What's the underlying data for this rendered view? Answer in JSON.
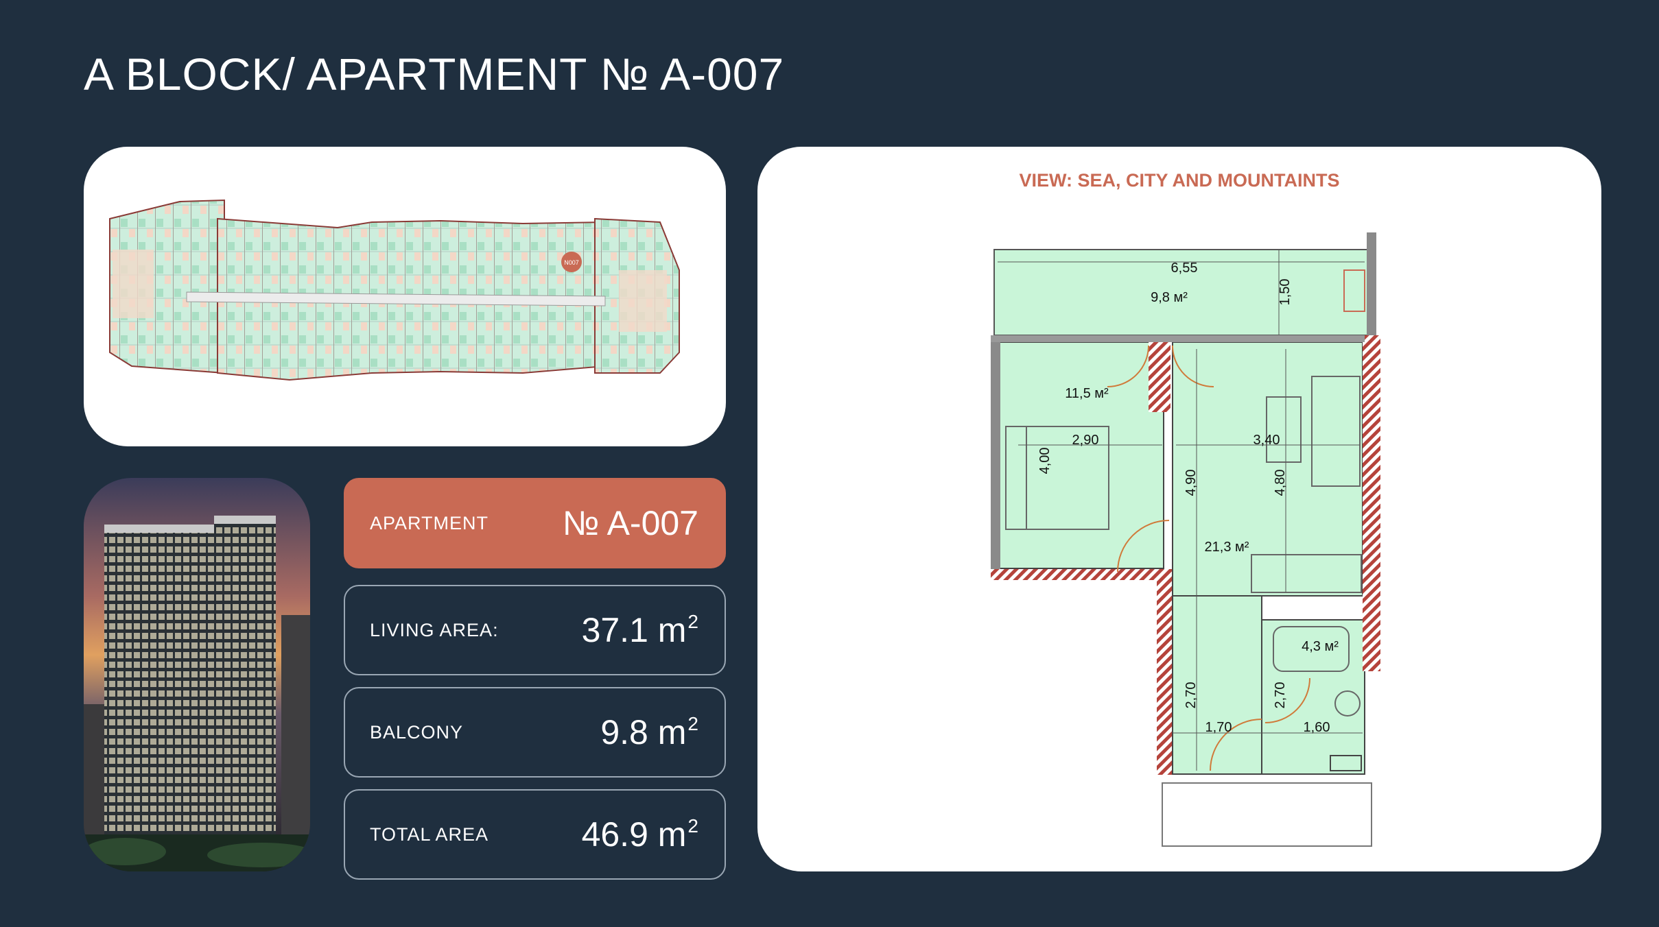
{
  "header": {
    "title": "A BLOCK/ APARTMENT № A-007"
  },
  "floorplan": {
    "marker": "N007"
  },
  "apartment": {
    "label": "APARTMENT",
    "number": "№ A-007",
    "living_area": {
      "label": "LIVING AREA:",
      "value": "37.1 m",
      "unit_sup": "2"
    },
    "balcony": {
      "label": "BALCONY",
      "value": "9.8 m",
      "unit_sup": "2"
    },
    "total_area": {
      "label": "TOTAL AREA",
      "value": "46.9 m",
      "unit_sup": "2"
    }
  },
  "plan": {
    "view": "VIEW: SEA, CITY AND MOUNTAINTS",
    "balcony_width": "6,55",
    "balcony_area": "9,8 м²",
    "balcony_depth": "1,50",
    "bedroom_area": "11,5 м²",
    "bedroom_width": "2,90",
    "bedroom_depth": "4,00",
    "living_width": "3,40",
    "living_depth_left": "4,90",
    "living_depth_right": "4,80",
    "living_area": "21,3 м²",
    "bath_area": "4,3 м²",
    "hall_depth": "2,70",
    "hall_width": "1,70",
    "bath_depth": "2,70",
    "bath_width": "1,60"
  },
  "colors": {
    "background": "#1f2f3f",
    "accent": "#c96a54",
    "room_fill": "#c9f5d8",
    "wall_hatch": "#b5433b"
  }
}
